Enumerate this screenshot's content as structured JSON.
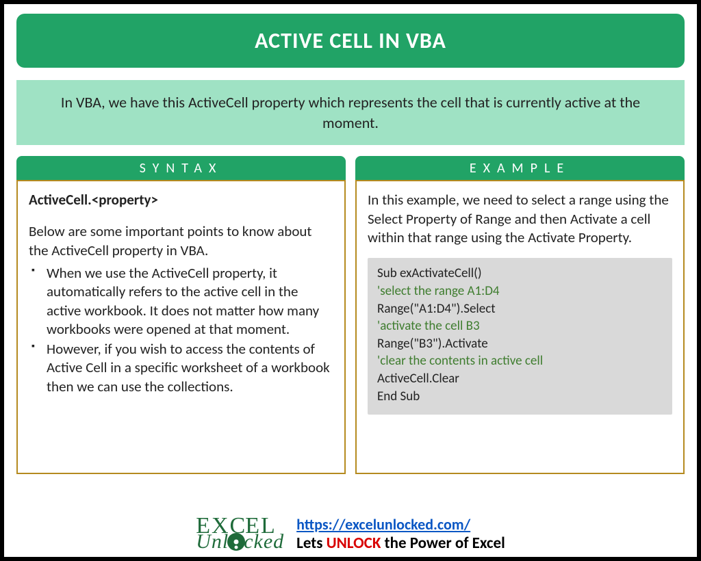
{
  "title": "ACTIVE CELL IN VBA",
  "intro": "In VBA, we have this ActiveCell property which represents the cell that is currently active at the moment.",
  "syntax": {
    "heading": "SYNTAX",
    "signature": "ActiveCell.<property>",
    "lead": "Below are some important points to know about the ActiveCell property in VBA.",
    "points": [
      "When we use the ActiveCell property, it automatically refers to the active cell in the active workbook. It does not matter how many workbooks were opened at that moment.",
      "However, if you wish to access the contents of Active Cell in a specific worksheet of a workbook then we can use the collections."
    ]
  },
  "example": {
    "heading": "EXAMPLE",
    "lead": "In this example, we need to select a range using the Select Property of Range and then Activate a cell within that range using the Activate Property.",
    "code": [
      {
        "t": "Sub exActivateCell()",
        "c": false
      },
      {
        "t": "'select the range A1:D4",
        "c": true
      },
      {
        "t": "Range(\"A1:D4\").Select",
        "c": false
      },
      {
        "t": "'activate the cell B3",
        "c": true
      },
      {
        "t": "Range(\"B3\").Activate",
        "c": false
      },
      {
        "t": "'clear the contents in active cell",
        "c": true
      },
      {
        "t": "ActiveCell.Clear",
        "c": false
      },
      {
        "t": "End Sub",
        "c": false
      }
    ]
  },
  "footer": {
    "logo_row1": "EX   EL",
    "logo_row2": "Unl   cked",
    "url": "https://excelunlocked.com/",
    "tag_pre": "Lets ",
    "tag_hi": "UNLOCK",
    "tag_post": " the Power of Excel"
  }
}
